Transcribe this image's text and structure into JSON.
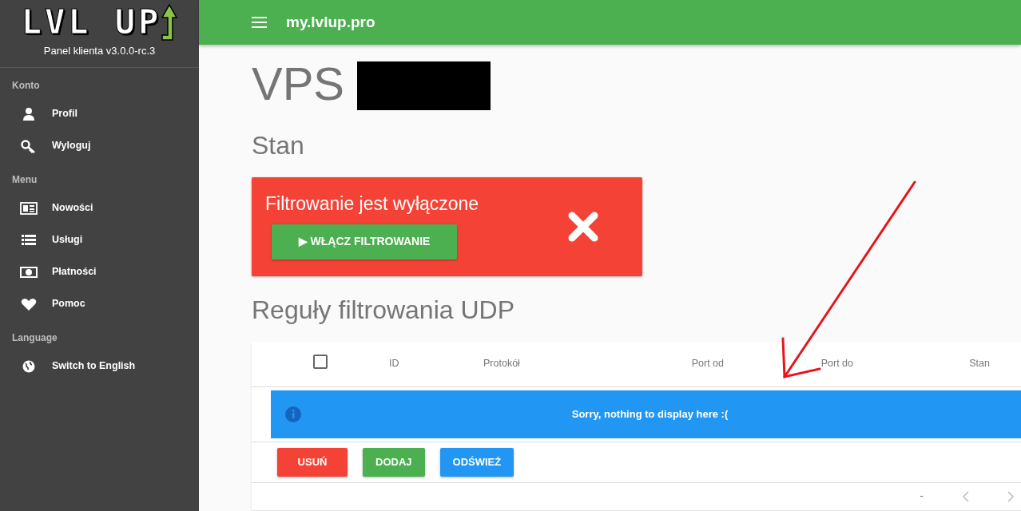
{
  "sidebar": {
    "logo": {
      "text": "LVL UP"
    },
    "subtitle": "Panel klienta v3.0.0-rc.3",
    "sections": [
      {
        "title": "Konto",
        "items": [
          {
            "label": "Profil",
            "kind": "profile"
          },
          {
            "label": "Wyloguj",
            "kind": "key"
          }
        ]
      },
      {
        "title": "Menu",
        "items": [
          {
            "label": "Nowości",
            "kind": "news"
          },
          {
            "label": "Usługi",
            "kind": "list"
          },
          {
            "label": "Płatności",
            "kind": "money"
          },
          {
            "label": "Pomoc",
            "kind": "heart"
          }
        ]
      },
      {
        "title": "Language",
        "items": [
          {
            "label": "Switch to English",
            "kind": "globe"
          }
        ]
      }
    ]
  },
  "topbar": {
    "title": "my.lvlup.pro"
  },
  "page": {
    "title": "VPS",
    "redacted": true,
    "status_heading": "Stan",
    "status_card": {
      "message": "Filtrowanie jest wyłączone",
      "button": "▶ WŁĄCZ FILTROWANIE",
      "enabled": false
    },
    "rules_heading": "Reguły filtrowania UDP",
    "table": {
      "select_all": {
        "checked": false
      },
      "columns": [
        {
          "label": "ID",
          "numeric": false
        },
        {
          "label": "Protokół",
          "numeric": false
        },
        {
          "label": "Port od",
          "numeric": true
        },
        {
          "label": "Port do",
          "numeric": true
        },
        {
          "label": "Stan",
          "numeric": true
        }
      ],
      "empty_message": "Sorry, nothing to display here :(",
      "buttons": [
        {
          "label": "USUŃ",
          "kind": "danger"
        },
        {
          "label": "DODAJ",
          "kind": "success"
        },
        {
          "label": "ODŚWIEŻ",
          "kind": "primary"
        }
      ],
      "pagination": {
        "range": "-"
      }
    }
  }
}
